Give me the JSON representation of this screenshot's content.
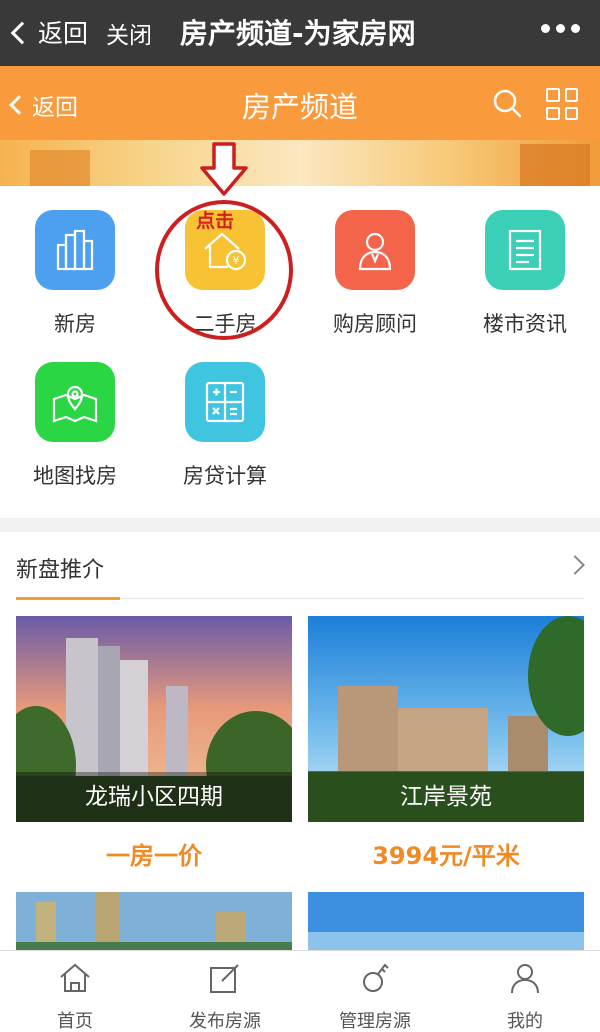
{
  "wechat_bar": {
    "back_label": "返回",
    "close_label": "关闭",
    "title": "房产频道-为家房网"
  },
  "header": {
    "back_label": "返回",
    "title": "房产频道"
  },
  "categories": [
    {
      "label": "新房",
      "color": "#4d9ff0",
      "icon": "buildings-icon"
    },
    {
      "label": "二手房",
      "color": "#f7c234",
      "icon": "house-yuan-icon"
    },
    {
      "label": "购房顾问",
      "color": "#f4644a",
      "icon": "advisor-icon"
    },
    {
      "label": "楼市资讯",
      "color": "#3ccfb8",
      "icon": "news-document-icon"
    },
    {
      "label": "地图找房",
      "color": "#2bd645",
      "icon": "map-pin-icon"
    },
    {
      "label": "房贷计算",
      "color": "#3fc5e0",
      "icon": "calculator-icon"
    }
  ],
  "annotation": {
    "click_text": "点击"
  },
  "new_listings": {
    "title": "新盘推介",
    "cards": [
      {
        "name": "龙瑞小区四期",
        "price": "一房一价"
      },
      {
        "name": "江岸景苑",
        "price": "3994元/平米"
      }
    ]
  },
  "tabbar": [
    {
      "label": "首页",
      "icon": "home-icon"
    },
    {
      "label": "发布房源",
      "icon": "edit-icon"
    },
    {
      "label": "管理房源",
      "icon": "key-icon"
    },
    {
      "label": "我的",
      "icon": "user-icon"
    }
  ],
  "colors": {
    "accent": "#f99a3c",
    "price": "#f08a24",
    "annotation": "#cc1f1f"
  }
}
